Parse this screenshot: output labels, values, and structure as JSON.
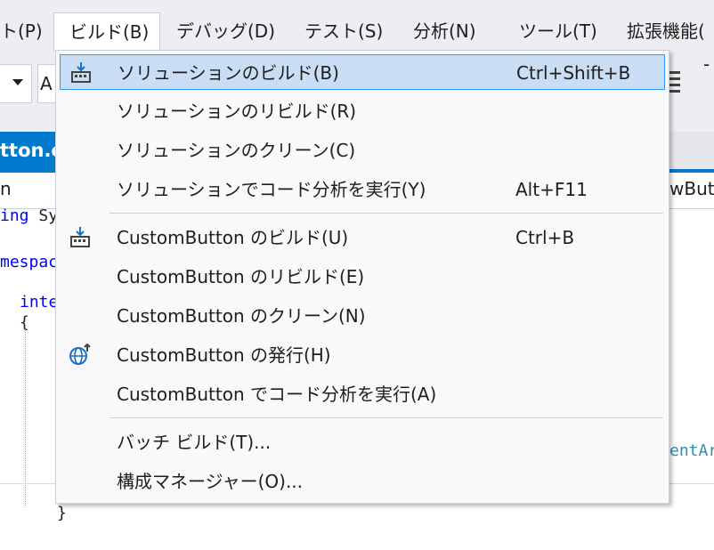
{
  "menubar": {
    "items": [
      "ト(P)",
      "ビルド(B)",
      "デバッグ(D)",
      "テスト(S)",
      "分析(N)",
      "ツール(T)",
      "拡張機能("
    ]
  },
  "toolbar": {
    "combo2_text": "A",
    "dash": "-"
  },
  "doc_tab": {
    "label": "tton.c"
  },
  "navbar": {
    "left_text": "n",
    "right_text": "wBut"
  },
  "code": {
    "line_using_kw": "ing",
    "line_using_rest": " Sy",
    "line_namespace": "mespac",
    "line_interface": "inte",
    "brace_open": "{",
    "teal_fragment": "entAr",
    "brace_close": "}"
  },
  "build_menu": {
    "items": [
      {
        "label": "ソリューションのビルド(B)",
        "shortcut": "Ctrl+Shift+B",
        "icon": "build-icon"
      },
      {
        "label": "ソリューションのリビルド(R)",
        "shortcut": ""
      },
      {
        "label": "ソリューションのクリーン(C)",
        "shortcut": ""
      },
      {
        "label": "ソリューションでコード分析を実行(Y)",
        "shortcut": "Alt+F11"
      },
      {
        "label": "CustomButton のビルド(U)",
        "shortcut": "Ctrl+B",
        "icon": "build-icon"
      },
      {
        "label": "CustomButton のリビルド(E)",
        "shortcut": ""
      },
      {
        "label": "CustomButton のクリーン(N)",
        "shortcut": ""
      },
      {
        "label": "CustomButton の発行(H)",
        "shortcut": "",
        "icon": "globe-publish-icon"
      },
      {
        "label": "CustomButton でコード分析を実行(A)",
        "shortcut": ""
      },
      {
        "label": "バッチ ビルド(T)...",
        "shortcut": ""
      },
      {
        "label": "構成マネージャー(O)...",
        "shortcut": ""
      }
    ]
  },
  "colors": {
    "accent": "#007acc",
    "highlight_bg": "#c9def5",
    "highlight_border": "#3399ff",
    "icon_blue": "#1e6fc4"
  }
}
